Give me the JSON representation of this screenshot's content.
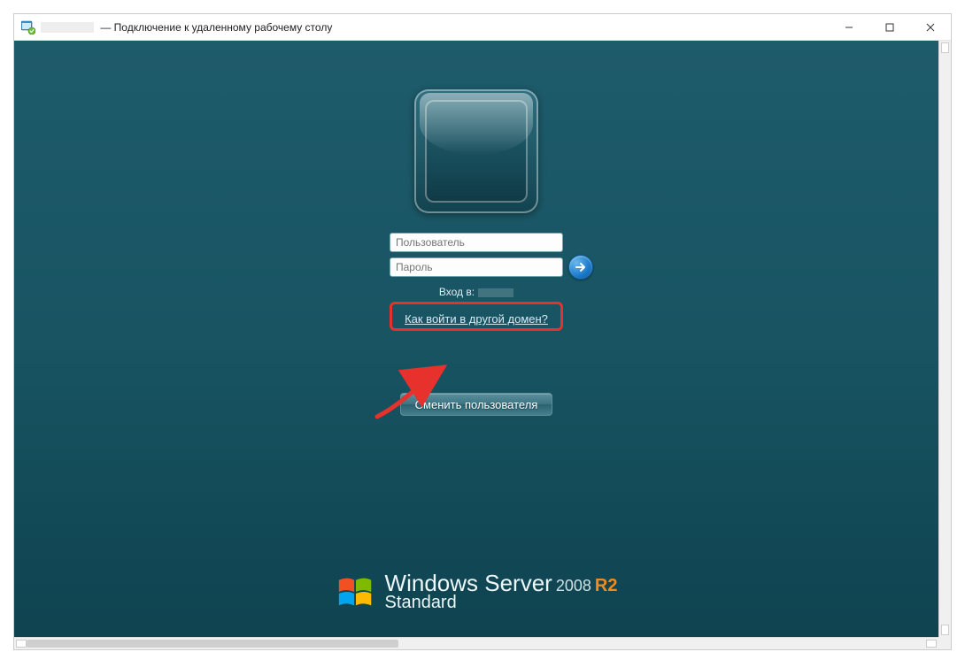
{
  "window": {
    "title_suffix": " — Подключение к удаленному рабочему столу"
  },
  "login": {
    "username_placeholder": "Пользователь",
    "password_placeholder": "Пароль",
    "domain_label": "Вход в:",
    "other_domain_link": "Как войти в другой домен?",
    "switch_user_label": "Сменить пользователя"
  },
  "branding": {
    "line1_prefix": "Windows Server",
    "year": "2008",
    "r2": "R2",
    "line2": "Standard"
  }
}
